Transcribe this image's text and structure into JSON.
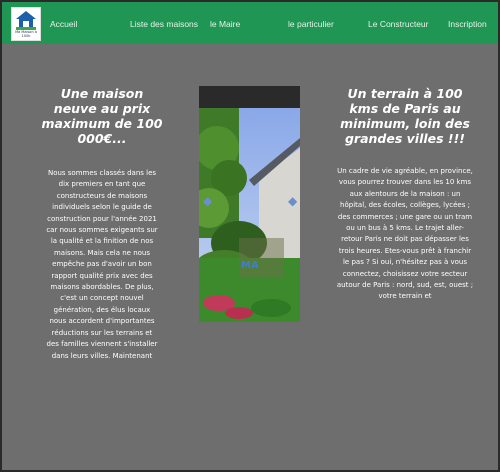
{
  "logo": {
    "text": "Ma Maison à 100k"
  },
  "nav": {
    "items": [
      {
        "label": "Accueil"
      },
      {
        "label": "Liste des maisons"
      },
      {
        "label": "le Maire"
      },
      {
        "label": "le particulier"
      },
      {
        "label": "Le Constructeur"
      },
      {
        "label": "Inscription"
      }
    ]
  },
  "left": {
    "heading": "Une maison neuve au prix maximum de 100 000€...",
    "body": "Nous sommes classés dans les dix premiers en tant que constructeurs de maisons individuels selon le guide de construction pour l'année 2021 car nous sommes exigeants sur la qualité et la finition de nos maisons. Mais cela ne nous empêche pas d'avoir un bon rapport qualité prix avec des maisons abordables. De plus, c'est un concept nouvel génération, des élus locaux nous accordent d'importantes réductions sur les terrains et des familles viennent s'installer dans leurs villes. Maintenant"
  },
  "right": {
    "heading": "Un terrain à 100 kms de Paris au minimum, loin des grandes villes !!!",
    "body": "Un cadre de vie agréable, en province, vous pourrez trouver dans les 10 kms aux alentours de la maison : un hôpital, des écoles, collèges, lycées ; des commerces ; une gare ou un tram ou un bus à 5 kms. Le trajet aller-retour Paris ne doit pas dépasser les trois heures. Etes-vous prêt à franchir le pas ? Si oui, n'hésitez pas à vous connectez, choisissez votre secteur autour de Paris : nord, sud, est, ouest ; votre terrain et"
  },
  "carousel": {
    "watermark": "MA",
    "prev_icon": "chevron-left-icon",
    "next_icon": "chevron-right-icon"
  },
  "colors": {
    "nav_bg": "#1f9654",
    "page_bg": "#6e6e6e",
    "text": "#ffffff"
  }
}
